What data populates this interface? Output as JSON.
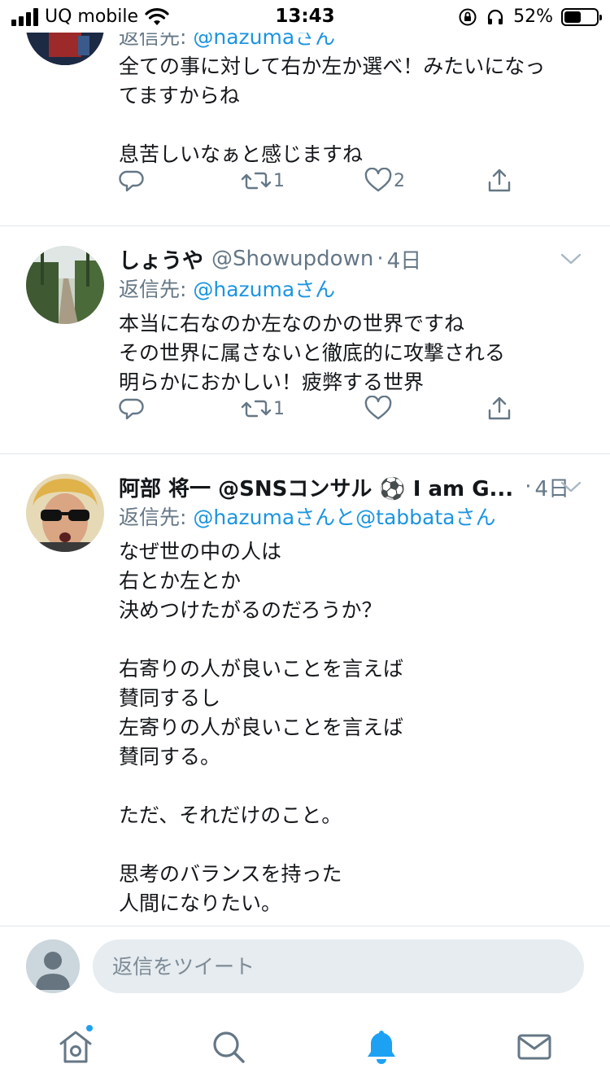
{
  "status_bar": {
    "carrier": "UQ mobile",
    "time": "13:43",
    "battery_percent": "52%",
    "battery_level": 0.52
  },
  "tweets": [
    {
      "reply_to_prefix": "返信先: ",
      "reply_to_mentions": "@hazumaさん",
      "body": "全ての事に対して右か左か選べ！みたいになっ\nてますからね\n\n息苦しいなぁと感じますね",
      "reply_count": "",
      "retweet_count": "1",
      "like_count": "2"
    },
    {
      "name": "しょうや",
      "handle": "@Showupdown",
      "dot": "·",
      "date": "4日",
      "reply_to_prefix": "返信先: ",
      "reply_to_mentions": "@hazumaさん",
      "body": "本当に右なのか左なのかの世界ですね\nその世界に属さないと徹底的に攻撃される\n明らかにおかしい！疲弊する世界",
      "reply_count": "",
      "retweet_count": "1",
      "like_count": ""
    },
    {
      "name": "阿部 将一 @SNSコンサル ⚽ I am G...",
      "handle": "",
      "dot": "·",
      "date": "4日",
      "reply_to_prefix": "返信先: ",
      "reply_to_mentions": "@hazumaさんと@tabbataさん",
      "body": "なぜ世の中の人は\n右とか左とか\n決めつけたがるのだろうか？\n\n右寄りの人が良いことを言えば\n賛同するし\n左寄りの人が良いことを言えば\n賛同する。\n\nただ、それだけのこと。\n\n思考のバランスを持った\n人間になりたい。"
    }
  ],
  "compose": {
    "placeholder": "返信をツイート"
  },
  "tabs": [
    "home",
    "search",
    "notifications",
    "messages"
  ],
  "colors": {
    "accent": "#1da1f2",
    "mention": "#1b95e0",
    "secondary_text": "#657786",
    "divider": "#e1e8ed"
  }
}
